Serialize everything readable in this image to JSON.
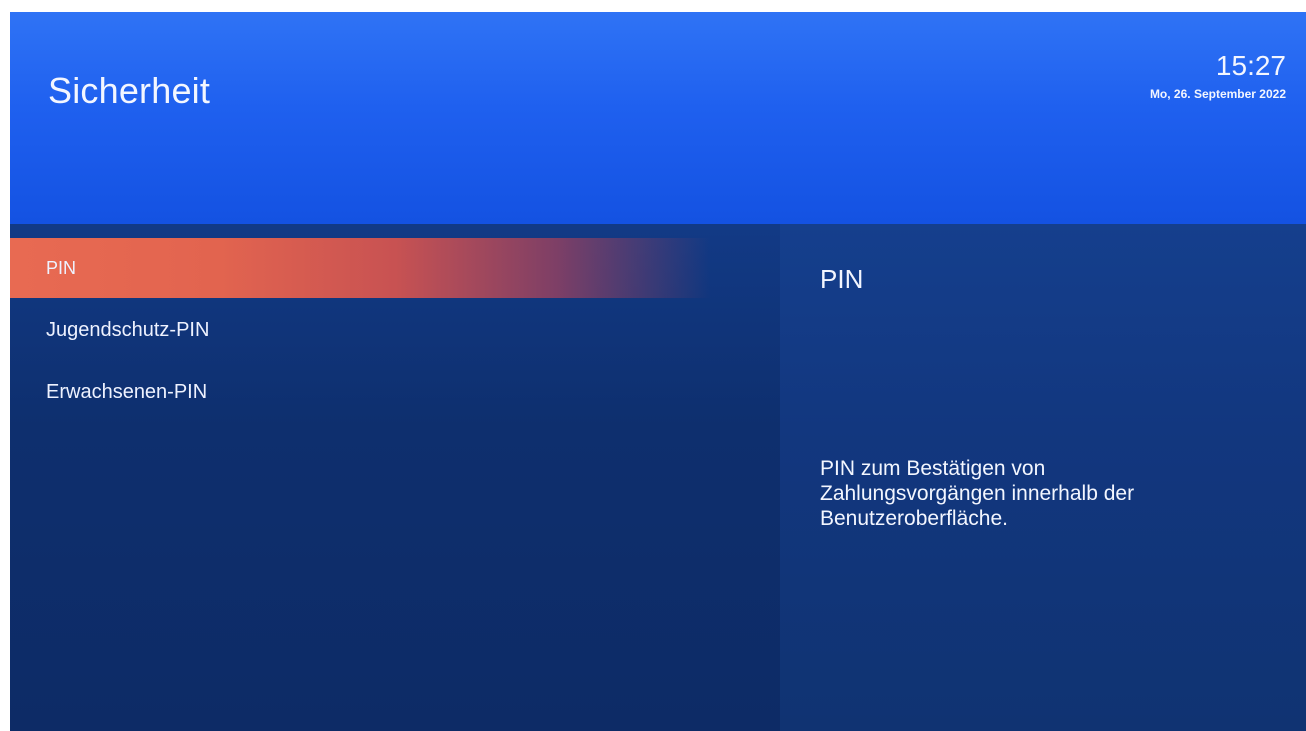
{
  "header": {
    "title": "Sicherheit",
    "time": "15:27",
    "date": "Mo, 26. September 2022"
  },
  "menu": {
    "items": [
      {
        "label": "PIN",
        "selected": true
      },
      {
        "label": "Jugendschutz-PIN",
        "selected": false
      },
      {
        "label": "Erwachsenen-PIN",
        "selected": false
      }
    ]
  },
  "detail": {
    "title": "PIN",
    "description": "PIN zum Bestätigen von Zahlungsvorgängen innerhalb der Benutzeroberfläche."
  },
  "colors": {
    "header_blue": "#1f60ef",
    "background_navy": "#0f2e6b",
    "selection_orange": "#e86a52"
  }
}
